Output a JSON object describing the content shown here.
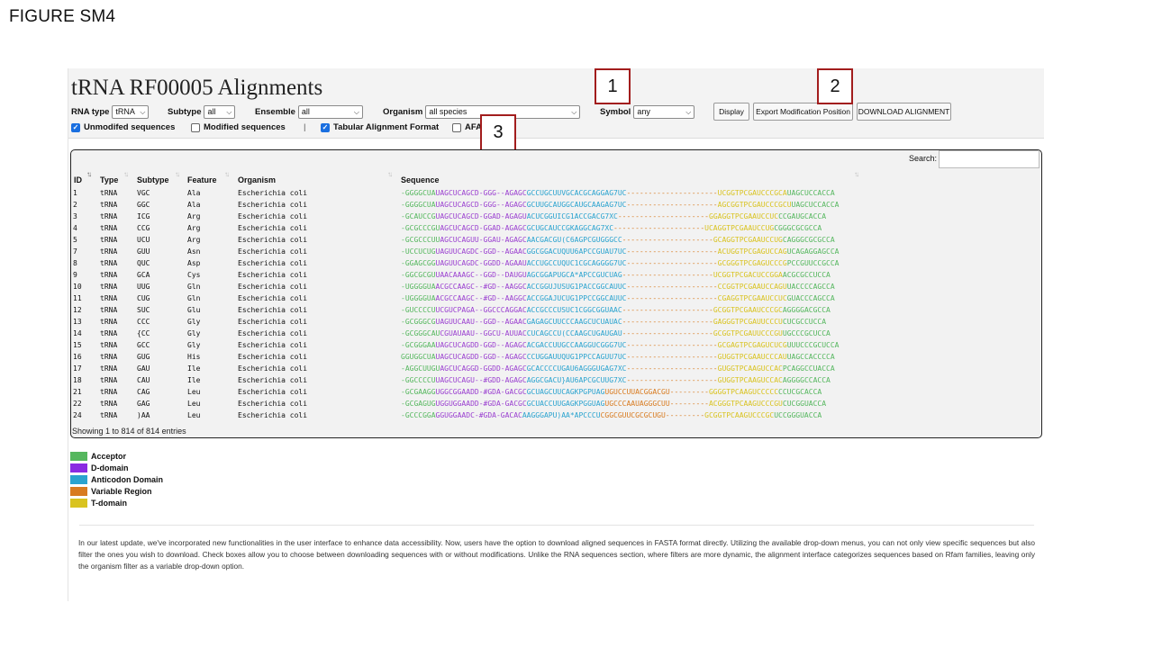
{
  "figure_label": "FIGURE SM4",
  "page_title": "tRNA RF00005 Alignments",
  "filters": {
    "rna_type": {
      "label": "RNA type",
      "value": "tRNA"
    },
    "subtype": {
      "label": "Subtype",
      "value": "all"
    },
    "ensemble": {
      "label": "Ensemble",
      "value": "all"
    },
    "organism": {
      "label": "Organism",
      "value": "all species"
    },
    "symbol": {
      "label": "Symbol",
      "value": "any"
    }
  },
  "buttons": {
    "display": "Display",
    "export": "Export Modification Position",
    "download": "DOWNLOAD ALIGNMENT"
  },
  "checkboxes": {
    "unmodified": {
      "label": "Unmodifed sequences",
      "checked": true
    },
    "modified": {
      "label": "Modified sequences",
      "checked": false
    },
    "separator": "|",
    "tabular": {
      "label": "Tabular Alignment Format",
      "checked": true
    },
    "afa": {
      "label": "AFA",
      "checked": false
    }
  },
  "callouts": {
    "c1": "1",
    "c2": "2",
    "c3": "3"
  },
  "table": {
    "search_label": "Search:",
    "columns": {
      "id": "ID",
      "type": "Type",
      "subtype": "Subtype",
      "feature": "Feature",
      "organism": "Organism",
      "sequence": "Sequence"
    },
    "rows": [
      {
        "id": "1",
        "type": "tRNA",
        "subtype": "VGC",
        "feature": "Ala",
        "organism": "Escherichia coli",
        "seq": [
          "-GGGGCUA",
          "UAGCUCAGCD-GGG--AGAGC",
          "GCCUGCUUVGCACGCAGGAG7UC",
          "---------------------",
          "UCGGTPCGAUCCCGCA",
          "UAGCUCCACCA"
        ]
      },
      {
        "id": "2",
        "type": "tRNA",
        "subtype": "GGC",
        "feature": "Ala",
        "organism": "Escherichia coli",
        "seq": [
          "-GGGGCUA",
          "UAGCUCAGCD-GGG--AGAGC",
          "GCUUGCAUGGCAUGCAAGAG7UC",
          "---------------------",
          "AGCGGTPCGAUCCCGCU",
          "UAGCUCCACCA"
        ]
      },
      {
        "id": "3",
        "type": "tRNA",
        "subtype": "ICG",
        "feature": "Arg",
        "organism": "Escherichia coli",
        "seq": [
          "-GCAUCCG",
          "UAGCUCAGCD-GGAD-AGAGU",
          "ACUCGGUICG1ACCGACG7XC",
          "---------------------",
          "GGAGGTPCGAAUCCUC",
          "CCGAUGCACCA"
        ]
      },
      {
        "id": "4",
        "type": "tRNA",
        "subtype": "CCG",
        "feature": "Arg",
        "organism": "Escherichia coli",
        "seq": [
          "-GCGCCCGU",
          "AGCUCAGCD-GGAD-AGAGC",
          "GCUGCAUCCGKAGGCAG7XC",
          "---------------------",
          "UCAGGTPCGAAUCCUG",
          "CGGGCGCGCCA"
        ]
      },
      {
        "id": "5",
        "type": "tRNA",
        "subtype": "UCU",
        "feature": "Arg",
        "organism": "Escherichia coli",
        "seq": [
          "-GCGCCCUU",
          "AGCUCAGUU-GGAU-AGAGC",
          "AACGACGU(C6AGPCGUGGGCC",
          "---------------------",
          "GCAGGTPCGAAUCCUG",
          "CAGGGCGCGCCA"
        ]
      },
      {
        "id": "7",
        "type": "tRNA",
        "subtype": "GUU",
        "feature": "Asn",
        "organism": "Escherichia coli",
        "seq": [
          "-UCCUCUG",
          "UAGUUCAGDC-GGD--AGAAC",
          "GGCGGACUQUU6APCCGUAU7UC",
          "---------------------",
          "ACUGGTPCGAGUCCAG",
          "UCAGAGGAGCCA"
        ]
      },
      {
        "id": "8",
        "type": "tRNA",
        "subtype": "QUC",
        "feature": "Asp",
        "organism": "Escherichia coli",
        "seq": [
          "-GGAGCGG",
          "UAGUUCAGDC-GGDD-AGAAU",
          "ACCUGCCUQUC1CGCAGGGG7UC",
          "---------------------",
          "GCGGGTPCGAGUCCCG",
          "PCCGUUCCGCCA"
        ]
      },
      {
        "id": "9",
        "type": "tRNA",
        "subtype": "GCA",
        "feature": "Cys",
        "organism": "Escherichia coli",
        "seq": [
          "-GGCGCGU",
          "UAACAAAGC--GGD--DAUGU",
          "AGCGGAPUGCA*APCCGUCUAG",
          "---------------------",
          "UCGGTPCGACUCCGGA",
          "ACGCGCCUCCA"
        ]
      },
      {
        "id": "10",
        "type": "tRNA",
        "subtype": "UUG",
        "feature": "Gln",
        "organism": "Escherichia coli",
        "seq": [
          "-UGGGGUA",
          "ACGCCAAGC--#GD--AAGGC",
          "ACCGGUJUSUG1PACCGGCAUUC",
          "---------------------",
          "CCGGTPCGAAUCCAGU",
          "UACCCCAGCCA"
        ]
      },
      {
        "id": "11",
        "type": "tRNA",
        "subtype": "CUG",
        "feature": "Gln",
        "organism": "Escherichia coli",
        "seq": [
          "-UGGGGUA",
          "ACGCCAAGC--#GD--AAGGC",
          "ACCGGAJUCUG1PPCCGGCAUUC",
          "---------------------",
          "CGAGGTPCGAAUCCUC",
          "GUACCCAGCCA"
        ]
      },
      {
        "id": "12",
        "type": "tRNA",
        "subtype": "SUC",
        "feature": "Glu",
        "organism": "Escherichia coli",
        "seq": [
          "-GUCCCCU",
          "UCGUCPAGA--GGCCCAGGAC",
          "ACCGCCCUSUC1CGGCGGUAAC",
          "---------------------",
          "GCGGTPCGAAUCCCGC",
          "AGGGGACGCCA"
        ]
      },
      {
        "id": "13",
        "type": "tRNA",
        "subtype": "CCC",
        "feature": "Gly",
        "organism": "Escherichia coli",
        "seq": [
          "-GCGGGCG",
          "UAGUUCAAU--GGD--AGAAC",
          "GAGAGCUUCCCAAGCUCUAUAC",
          "---------------------",
          "GAGGGTPCGAUUCCCU",
          "CUCGCCUCCA"
        ]
      },
      {
        "id": "14",
        "type": "tRNA",
        "subtype": "{CC",
        "feature": "Gly",
        "organism": "Escherichia coli",
        "seq": [
          "-GCGGGCAU",
          "CGUAUAAU--GGCU-AUUAC",
          "CUCAGCCU(CCAAGCUGAUGAU",
          "---------------------",
          "GCGGTPCGAUUCCCGU",
          "UGCCCGCUCCA"
        ]
      },
      {
        "id": "15",
        "type": "tRNA",
        "subtype": "GCC",
        "feature": "Gly",
        "organism": "Escherichia coli",
        "seq": [
          "-GCGGGAA",
          "UAGCUCAGDD-GGD--AGAGC",
          "ACGACCUUGCCAAGGUCGGG7UC",
          "---------------------",
          "GCGAGTPCGAGUCUCG",
          "UUUCCCGCUCCA"
        ]
      },
      {
        "id": "16",
        "type": "tRNA",
        "subtype": "GUG",
        "feature": "His",
        "organism": "Escherichia coli",
        "seq": [
          "GGUGGCUA",
          "UAGCUCAGDD-GGD--AGAGC",
          "CCUGGAUUQUG1PPCCAGUU7UC",
          "---------------------",
          "GUGGTPCGAAUCCCAU",
          "UAGCCACCCCA"
        ]
      },
      {
        "id": "17",
        "type": "tRNA",
        "subtype": "GAU",
        "feature": "Ile",
        "organism": "Escherichia coli",
        "seq": [
          "-AGGCUUGU",
          "AGCUCAGGD-GGDD-AGAGC",
          "GCACCCCUGAU6AGGGUGAG7XC",
          "---------------------",
          "GUGGTPCAAGUCCAC",
          "PCAGGCCUACCA"
        ]
      },
      {
        "id": "18",
        "type": "tRNA",
        "subtype": "CAU",
        "feature": "Ile",
        "organism": "Escherichia coli",
        "seq": [
          "-GGCCCCU",
          "UAGCUCAGU--#GDD-AGAGC",
          "AGGCGACU}AU6APCGCUUG7XC",
          "---------------------",
          "GUGGTPCAAGUCCAC",
          "AGGGGCCACCA"
        ]
      },
      {
        "id": "21",
        "type": "tRNA",
        "subtype": "CAG",
        "feature": "Leu",
        "organism": "Escherichia coli",
        "seq": [
          "-GCGAAGG",
          "UGGCGGAADD-#GDA-GACGC",
          "GCUAGCUUCAGKPGPUAG",
          "UGUCCUUACGGACGU---------",
          "GGGGTPCAAGUCCCCC",
          "CCUCGCACCA"
        ]
      },
      {
        "id": "22",
        "type": "tRNA",
        "subtype": "GAG",
        "feature": "Leu",
        "organism": "Escherichia coli",
        "seq": [
          "-GCGAGUG",
          "UGGUGGAADD-#GDA-GACGC",
          "GCUACCUUGAGKPGGUAG",
          "UGCCCAAUAGGGCUU---------",
          "ACGGGTPCAAGUCCCGU",
          "CUCGGUACCA"
        ]
      },
      {
        "id": "24",
        "type": "tRNA",
        "subtype": ")AA",
        "feature": "Leu",
        "organism": "Escherichia coli",
        "seq": [
          "-GCCCGGA",
          "GGUGGAADC-#GDA-GACAC",
          "AAGGGAPU)AA*APCCCU",
          "CGGCGUUCGCGCUGU---------",
          "GCGGTPCAAGUCCCGC",
          "UCCGGGUACCA"
        ]
      }
    ],
    "showing_text": "Showing 1 to 814 of 814 entries"
  },
  "legend": [
    {
      "label": "Acceptor",
      "color": "#55b75e"
    },
    {
      "label": "D-domain",
      "color": "#8a2be2"
    },
    {
      "label": "Anticodon Domain",
      "color": "#2aa3cf"
    },
    {
      "label": "Variable Region",
      "color": "#d87b20"
    },
    {
      "label": "T-domain",
      "color": "#d9c320"
    }
  ],
  "description": "In our latest update, we've incorporated new functionalities in the user interface to enhance data accessibility. Now, users have the option to download aligned sequences in FASTA format directly. Utilizing the available drop-down menus, you can not only view specific sequences but also filter the ones you wish to download. Check boxes allow you to choose between downloading sequences with or without modifications. Unlike the RNA sequences section, where filters are more dynamic, the alignment interface categorizes sequences based on Rfam families, leaving only the organism filter as a variable drop-down option."
}
